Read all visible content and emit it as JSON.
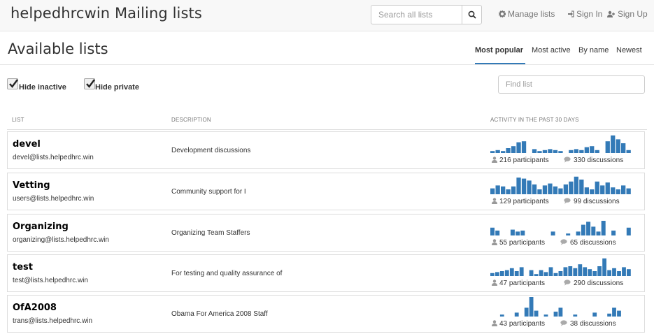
{
  "brand": "helpedhrcwin Mailing lists",
  "search": {
    "placeholder": "Search all lists"
  },
  "nav": {
    "manage": "Manage lists",
    "signin": "Sign In",
    "signup": "Sign Up"
  },
  "page": {
    "title": "Available lists",
    "sort_tabs": [
      "Most popular",
      "Most active",
      "By name",
      "Newest"
    ],
    "active_sort": "Most popular"
  },
  "filters": {
    "hide_inactive": "Hide inactive",
    "hide_private": "Hide private",
    "hide_inactive_checked": true,
    "hide_private_checked": true,
    "find_placeholder": "Find list"
  },
  "columns": {
    "list": "LIST",
    "description": "DESCRIPTION",
    "activity": "ACTIVITY IN THE PAST 30 DAYS"
  },
  "accent_color": "#337ab7",
  "lists": [
    {
      "name": "devel",
      "address": "devel@lists.helpedhrc.win",
      "description": "Development discussions",
      "participants": "216 participants",
      "discussions": "330 discussions",
      "activity": [
        2,
        3,
        2,
        5,
        7,
        11,
        12,
        0,
        4,
        2,
        3,
        4,
        3,
        2,
        0,
        3,
        4,
        3,
        6,
        7,
        3,
        0,
        12,
        18,
        14,
        10,
        3
      ]
    },
    {
      "name": "Vetting",
      "address": "users@lists.helpedhrc.win",
      "description": "Community support for I",
      "participants": "129 participants",
      "discussions": "99 discussions",
      "activity": [
        6,
        9,
        8,
        5,
        8,
        17,
        16,
        14,
        10,
        5,
        9,
        11,
        8,
        6,
        10,
        13,
        18,
        15,
        7,
        5,
        13,
        9,
        12,
        7,
        5,
        9,
        6
      ]
    },
    {
      "name": "Organizing",
      "address": "organizing@lists.helpedhrc.win",
      "description": "Organizing Team Staffers",
      "participants": "55 participants",
      "discussions": "65 discussions",
      "activity": [
        8,
        5,
        0,
        0,
        6,
        4,
        5,
        0,
        0,
        0,
        0,
        0,
        4,
        0,
        0,
        2,
        0,
        4,
        11,
        14,
        9,
        4,
        15,
        0,
        5,
        0,
        0,
        8
      ]
    },
    {
      "name": "test",
      "address": "test@lists.helpedhrc.win",
      "description": "For testing and quality assurance of",
      "participants": "47 participants",
      "discussions": "290 discussions",
      "activity": [
        3,
        4,
        5,
        6,
        8,
        5,
        9,
        0,
        6,
        2,
        6,
        4,
        9,
        3,
        5,
        9,
        10,
        8,
        12,
        9,
        7,
        5,
        10,
        18,
        6,
        8,
        5,
        9,
        7
      ]
    },
    {
      "name": "OfA2008",
      "address": "trans@lists.helpedhrc.win",
      "description": "Obama For America 2008 Staff",
      "participants": "43 participants",
      "discussions": "38 discussions",
      "activity": [
        0,
        0,
        2,
        0,
        0,
        4,
        0,
        9,
        20,
        6,
        0,
        2,
        0,
        5,
        9,
        0,
        0,
        2,
        0,
        0,
        0,
        4,
        0,
        0,
        3,
        9,
        6,
        0,
        0
      ]
    }
  ]
}
